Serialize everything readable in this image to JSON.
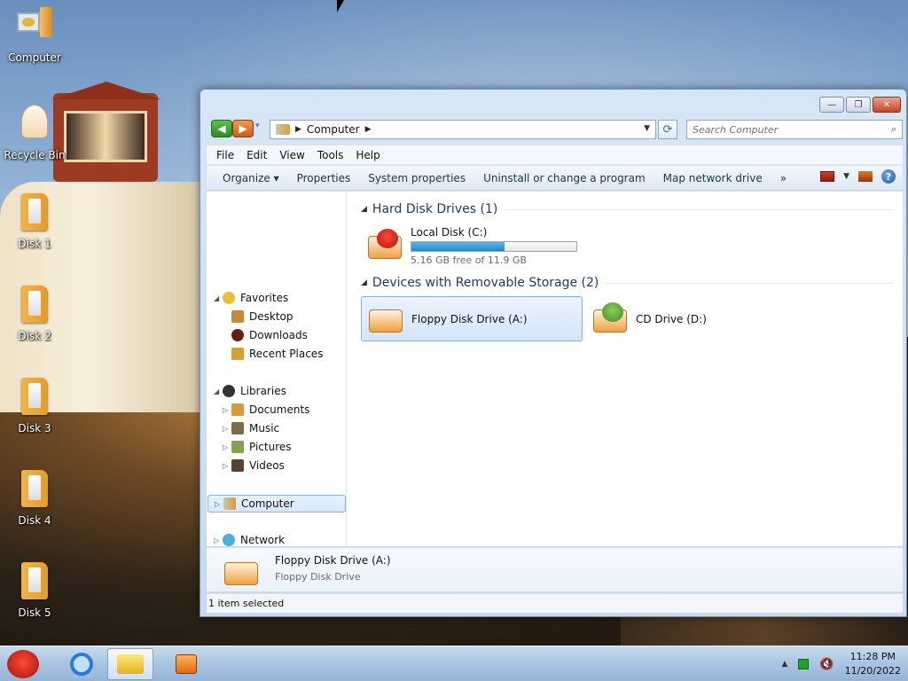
{
  "desktop": {
    "icons": [
      {
        "label": "Computer"
      },
      {
        "label": "Recycle Bin"
      },
      {
        "label": "Disk 1"
      },
      {
        "label": "Disk 2"
      },
      {
        "label": "Disk 3"
      },
      {
        "label": "Disk 4"
      },
      {
        "label": "Disk 5"
      }
    ]
  },
  "window": {
    "caption_buttons": {
      "minimize": "—",
      "maximize": "❐",
      "close": "✕"
    },
    "address": {
      "crumb": "Computer"
    },
    "search": {
      "placeholder": "Search Computer"
    },
    "menu": [
      "File",
      "Edit",
      "View",
      "Tools",
      "Help"
    ],
    "toolbar": {
      "organize": "Organize ▾",
      "properties": "Properties",
      "system_properties": "System properties",
      "uninstall": "Uninstall or change a program",
      "map_drive": "Map network drive",
      "more": "»",
      "help": "?"
    },
    "nav": {
      "favorites": "Favorites",
      "desktop": "Desktop",
      "downloads": "Downloads",
      "recent": "Recent Places",
      "libraries": "Libraries",
      "documents": "Documents",
      "music": "Music",
      "pictures": "Pictures",
      "videos": "Videos",
      "computer": "Computer",
      "network": "Network"
    },
    "groups": {
      "hdd": "Hard Disk Drives (1)",
      "removable": "Devices with Removable Storage (2)"
    },
    "drives": {
      "c": {
        "name": "Local Disk (C:)",
        "free": "5.16 GB free of 11.9 GB",
        "used_fraction": 0.566
      },
      "a": {
        "name": "Floppy Disk Drive (A:)"
      },
      "d": {
        "name": "CD Drive (D:)"
      }
    },
    "details": {
      "name": "Floppy Disk Drive (A:)",
      "type": "Floppy Disk Drive"
    },
    "status": "1 item selected"
  },
  "taskbar": {
    "time": "11:28 PM",
    "date": "11/20/2022"
  },
  "colors": {
    "accent": "#2a84c4",
    "selection": "#d3e6fb",
    "taskbar": "#a9c4e0"
  }
}
